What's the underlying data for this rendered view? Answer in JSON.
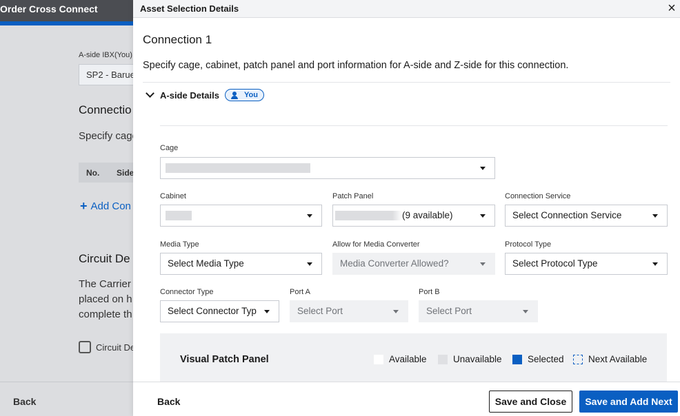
{
  "background": {
    "app_title": "Order Cross Connect",
    "aside_label": "A-side IBX(You)",
    "aside_value": "SP2 - Barue",
    "connection_heading": "Connectio",
    "connection_desc": "Specify cage",
    "table_headers": [
      "No.",
      "Side"
    ],
    "add_link": "Add Con",
    "circuit_heading": "Circuit De",
    "carrier_lines": [
      "The Carrier",
      "placed on h",
      "complete th"
    ],
    "checkbox_label": "Circuit De",
    "back_label": "Back"
  },
  "drawer": {
    "title": "Asset Selection Details",
    "close_icon": "×",
    "connection_title": "Connection 1",
    "description": "Specify cage, cabinet, patch panel and port information for A-side and Z-side for this connection.",
    "aside_toggle_label": "A-side Details",
    "you_badge": "You",
    "fields": {
      "cage": {
        "label": "Cage"
      },
      "cabinet": {
        "label": "Cabinet"
      },
      "patch_panel": {
        "label": "Patch Panel",
        "value_suffix": "(9 available)"
      },
      "connection_service": {
        "label": "Connection Service",
        "placeholder": "Select Connection Service"
      },
      "media_type": {
        "label": "Media Type",
        "placeholder": "Select Media Type"
      },
      "media_converter": {
        "label": "Allow for Media Converter",
        "placeholder": "Media Converter Allowed?"
      },
      "protocol_type": {
        "label": "Protocol Type",
        "placeholder": "Select Protocol Type"
      },
      "connector_type": {
        "label": "Connector Type",
        "placeholder": "Select Connector Typ"
      },
      "port_a": {
        "label": "Port A",
        "placeholder": "Select Port"
      },
      "port_b": {
        "label": "Port B",
        "placeholder": "Select Port"
      }
    },
    "visual_patch_panel": {
      "title": "Visual Patch Panel",
      "legend": [
        "Available",
        "Unavailable",
        "Selected",
        "Next Available"
      ]
    },
    "footer": {
      "back": "Back",
      "save_close": "Save and Close",
      "save_next": "Save and Add Next"
    }
  },
  "colors": {
    "accent": "#0a5fc2",
    "header_dark": "#4b4d52"
  }
}
